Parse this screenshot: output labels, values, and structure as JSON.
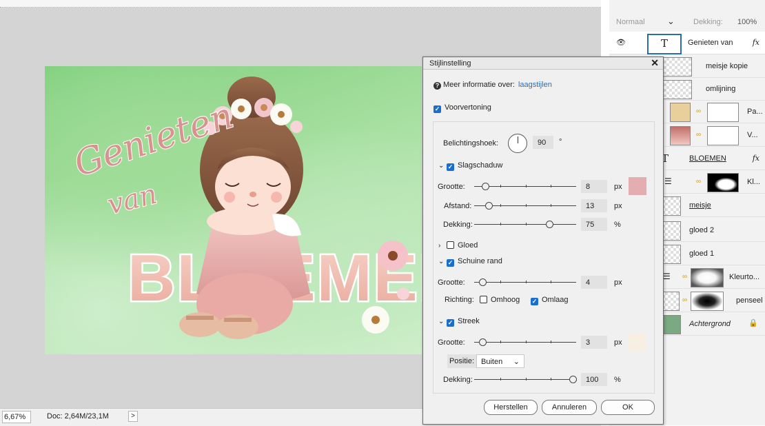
{
  "canvas_area": {
    "artwork": {
      "word_genieten": "Genieten",
      "word_van": "van",
      "word_bloemen": "BLOEMEN"
    }
  },
  "status": {
    "zoom": "6,67%",
    "doc": "Doc: 2,64M/23,1M",
    "arrow": ">"
  },
  "layers_panel": {
    "blend_mode": "Normaal",
    "opacity_label": "Dekking:",
    "opacity_value": "100%",
    "layers": [
      {
        "name": "Genieten van",
        "type": "text",
        "fx": true,
        "visible": true,
        "selected": true
      },
      {
        "name": "meisje kopie",
        "type": "image"
      },
      {
        "name": "omlijning",
        "type": "image"
      },
      {
        "name": "Pa...",
        "type": "image-mask"
      },
      {
        "name": "V...",
        "type": "image-mask"
      },
      {
        "name": "BLOEMEN",
        "type": "text",
        "fx": true
      },
      {
        "name": "Kl...",
        "type": "adjustment-mask"
      },
      {
        "name": "meisje",
        "type": "image"
      },
      {
        "name": "gloed 2",
        "type": "image"
      },
      {
        "name": "gloed 1",
        "type": "image"
      },
      {
        "name": "Kleurto...",
        "type": "adjustment-mask"
      },
      {
        "name": "penseel",
        "type": "image-mask"
      },
      {
        "name": "Achtergrond",
        "type": "background",
        "locked": true
      }
    ],
    "text_layer_glyph": "T",
    "fx_glyph": "fx"
  },
  "dialog": {
    "title": "Stijlinstelling",
    "close_glyph": "✕",
    "info_text": "Meer informatie over:",
    "info_link": "laagstijlen",
    "preview_label": "Voorvertoning",
    "preview_checked": true,
    "light_angle_label": "Belichtingshoek:",
    "light_angle_value": "90",
    "degree": "°",
    "drop_shadow": {
      "label": "Slagschaduw",
      "checked": true,
      "size_label": "Grootte:",
      "size_value": "8",
      "distance_label": "Afstand:",
      "distance_value": "13",
      "opacity_label": "Dekking:",
      "opacity_value": "75",
      "color": "#e4aeb0"
    },
    "glow": {
      "label": "Gloed",
      "checked": false
    },
    "bevel": {
      "label": "Schuine rand",
      "checked": true,
      "size_label": "Grootte:",
      "size_value": "4",
      "direction_label": "Richting:",
      "up_label": "Omhoog",
      "up_checked": false,
      "down_label": "Omlaag",
      "down_checked": true
    },
    "stroke": {
      "label": "Streek",
      "checked": true,
      "size_label": "Grootte:",
      "size_value": "3",
      "position_label": "Positie:",
      "position_value": "Buiten",
      "opacity_label": "Dekking:",
      "opacity_value": "100",
      "color": "#f7efe2"
    },
    "unit_px": "px",
    "unit_pct": "%",
    "buttons": {
      "reset": "Herstellen",
      "cancel": "Annuleren",
      "ok": "OK"
    }
  }
}
